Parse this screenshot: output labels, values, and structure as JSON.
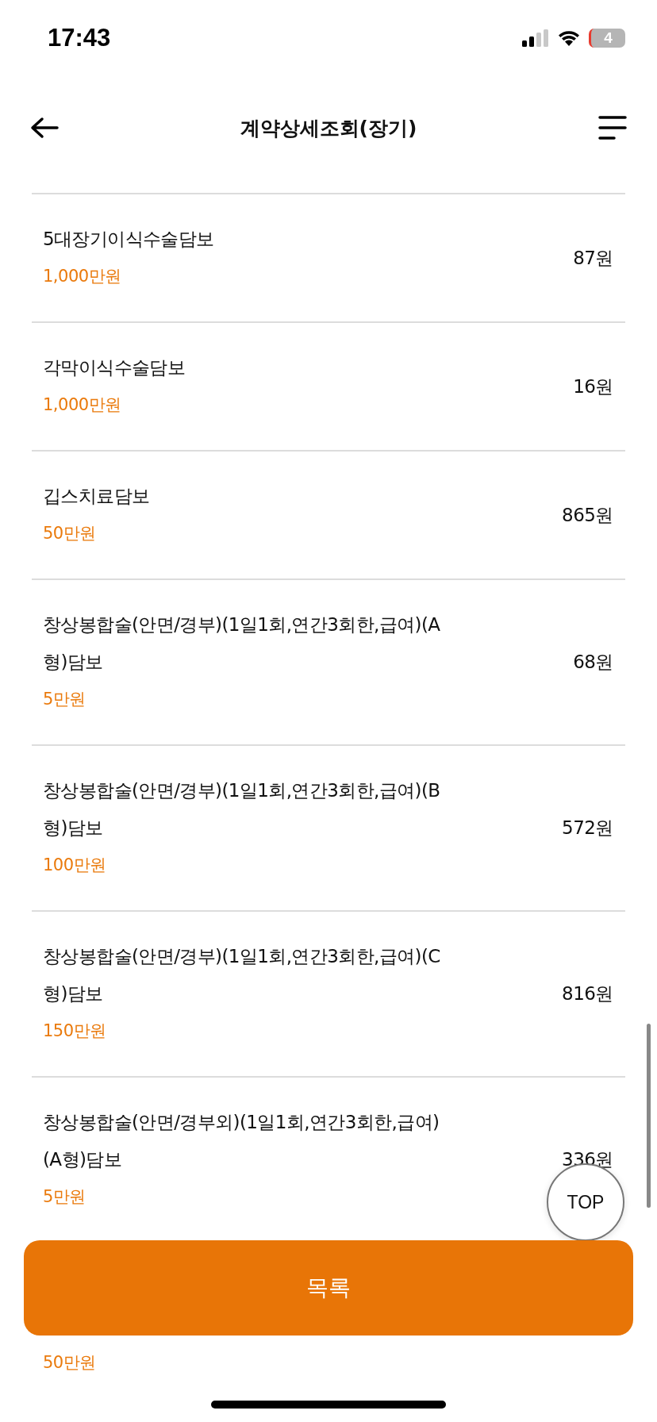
{
  "status_bar": {
    "time": "17:43",
    "battery": "4"
  },
  "header": {
    "title": "계약상세조회(장기)"
  },
  "coverages": [
    {
      "kind": "full",
      "name": "5대장기이식수술담보",
      "amount": "1,000만원",
      "premium": "87원"
    },
    {
      "kind": "full",
      "name": "각막이식수술담보",
      "amount": "1,000만원",
      "premium": "16원"
    },
    {
      "kind": "full",
      "name": "깁스치료담보",
      "amount": "50만원",
      "premium": "865원"
    },
    {
      "kind": "full",
      "name": "창상봉합술(안면/경부)(1일1회,연간3회한,급여)(A형)담보",
      "amount": "5만원",
      "premium": "68원"
    },
    {
      "kind": "full",
      "name": "창상봉합술(안면/경부)(1일1회,연간3회한,급여)(B형)담보",
      "amount": "100만원",
      "premium": "572원"
    },
    {
      "kind": "full",
      "name": "창상봉합술(안면/경부)(1일1회,연간3회한,급여)(C형)담보",
      "amount": "150만원",
      "premium": "816원"
    },
    {
      "kind": "full",
      "name": "창상봉합술(안면/경부외)(1일1회,연간3회한,급여)(A형)담보",
      "amount": "5만원",
      "premium": "336원"
    },
    {
      "kind": "covered",
      "amount": "50만원"
    }
  ],
  "top_button": {
    "label": "TOP"
  },
  "list_button": {
    "label": "목록"
  }
}
